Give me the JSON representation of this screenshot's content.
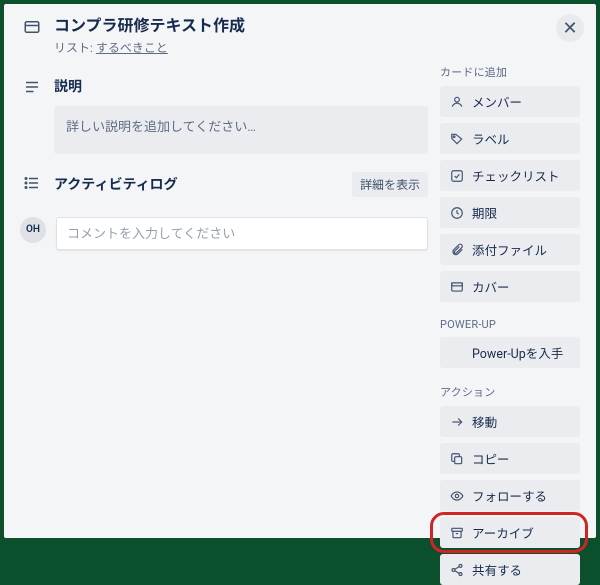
{
  "header": {
    "title": "コンプラ研修テキスト作成",
    "list_prefix": "リスト: ",
    "list_name": "するべきこと"
  },
  "description": {
    "heading": "説明",
    "placeholder": "詳しい説明を追加してください…"
  },
  "activity": {
    "heading": "アクティビティログ",
    "detail_button": "詳細を表示",
    "avatar_initials": "OH",
    "comment_placeholder": "コメントを入力してください"
  },
  "sidebar": {
    "add_to_card": {
      "heading": "カードに追加",
      "items": [
        {
          "icon": "user-icon",
          "label": "メンバー"
        },
        {
          "icon": "tag-icon",
          "label": "ラベル"
        },
        {
          "icon": "checklist-icon",
          "label": "チェックリスト"
        },
        {
          "icon": "clock-icon",
          "label": "期限"
        },
        {
          "icon": "paperclip-icon",
          "label": "添付ファイル"
        },
        {
          "icon": "cover-icon",
          "label": "カバー"
        }
      ]
    },
    "powerup": {
      "heading": "POWER-UP",
      "items": [
        {
          "icon": "",
          "label": "Power-Upを入手"
        }
      ]
    },
    "actions": {
      "heading": "アクション",
      "items": [
        {
          "icon": "arrow-right-icon",
          "label": "移動"
        },
        {
          "icon": "copy-icon",
          "label": "コピー"
        },
        {
          "icon": "eye-icon",
          "label": "フォローする"
        },
        {
          "icon": "archive-icon",
          "label": "アーカイブ",
          "highlight": true
        },
        {
          "icon": "share-icon",
          "label": "共有する"
        }
      ]
    }
  }
}
